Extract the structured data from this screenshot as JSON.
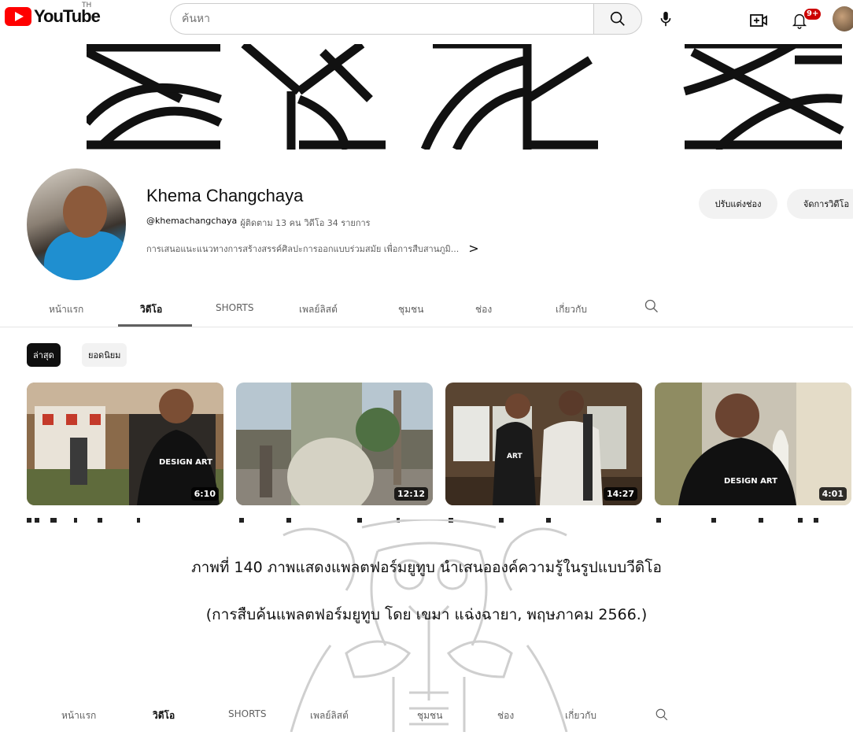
{
  "header": {
    "logo_text": "YouTube",
    "country_code": "TH",
    "search_placeholder": "ค้นหา",
    "notification_count": "9+"
  },
  "channel": {
    "name": "Khema Changchaya",
    "handle": "@khemachangchaya",
    "subscribers": "ผู้ติดตาม 13 คน",
    "video_count": "วิดีโอ 34 รายการ",
    "description": "การเสนอแนะแนวทางการสร้างสรรค์ศิลปะการออกแบบร่วมสมัย เพื่อการสืบสานภูมิ...",
    "more_glyph": ">",
    "customize_button": "ปรับแต่งช่อง",
    "manage_button": "จัดการวิดีโอ"
  },
  "tabs": [
    "หน้าแรก",
    "วิดีโอ",
    "SHORTS",
    "เพลย์ลิสต์",
    "ชุมชน",
    "ช่อง",
    "เกี่ยวกับ"
  ],
  "active_tab": "วิดีโอ",
  "chips": [
    "ล่าสุด",
    "ยอดนิยม"
  ],
  "videos": [
    {
      "duration": "6:10",
      "shirt_text": "DESIGN ART"
    },
    {
      "duration": "12:12"
    },
    {
      "duration": "14:27",
      "shirt_text": "ART"
    },
    {
      "duration": "4:01",
      "shirt_text": "DESIGN ART"
    }
  ],
  "caption": {
    "line1": "ภาพที่ 140 ภาพแสดงแพลตฟอร์มยูทูบ นำเสนอองค์ความรู้ในรูปแบบวีดิโอ",
    "line2": "(การสืบค้นแพลตฟอร์มยูทูบ โดย เขมา แฉ่งฉายา, พฤษภาคม 2566.)"
  },
  "colors": {
    "brand_red": "#ff0000",
    "chip_active": "#0f0f0f",
    "badge_red": "#cc0000",
    "muted_text": "#606060"
  }
}
